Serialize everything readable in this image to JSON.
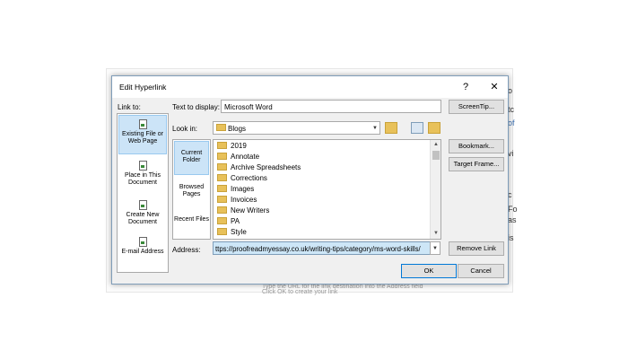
{
  "doc": {
    "right_fragments": [
      "o",
      "tc",
      "of",
      "vi",
      "c",
      "Fo",
      "as",
      "is"
    ],
    "bottom_lines": [
      "Type the URL for the link destination into the Address field",
      "Click OK to create your link"
    ]
  },
  "dialog": {
    "title": "Edit Hyperlink",
    "help_label": "?",
    "close_label": "✕",
    "link_to_label": "Link to:",
    "text_to_display_label": "Text to display:",
    "text_to_display_value": "Microsoft Word",
    "screentip_label": "ScreenTip...",
    "look_in_label": "Look in:",
    "look_in_value": "Blogs",
    "bookmark_label": "Bookmark...",
    "target_frame_label": "Target Frame...",
    "address_label": "Address:",
    "address_value": "ttps://proofreadmyessay.co.uk/writing-tips/category/ms-word-skills/",
    "remove_link_label": "Remove Link",
    "ok_label": "OK",
    "cancel_label": "Cancel"
  },
  "sidebar": {
    "items": [
      {
        "label": "Existing File or Web Page",
        "selected": true
      },
      {
        "label": "Place in This Document",
        "selected": false
      },
      {
        "label": "Create New Document",
        "selected": false
      },
      {
        "label": "E-mail Address",
        "selected": false
      }
    ]
  },
  "panel": {
    "items": [
      {
        "label": "Current Folder",
        "selected": true
      },
      {
        "label": "Browsed Pages",
        "selected": false
      },
      {
        "label": "Recent Files",
        "selected": false
      }
    ]
  },
  "files": [
    "2019",
    "Annotate",
    "Archive Spreadsheets",
    "Corrections",
    "Images",
    "Invoices",
    "New Writers",
    "PA",
    "Style"
  ],
  "icons": {
    "folder_color": "#e8c15a",
    "selection_color": "#cce4f7",
    "address_highlight": "#cde6f7"
  }
}
